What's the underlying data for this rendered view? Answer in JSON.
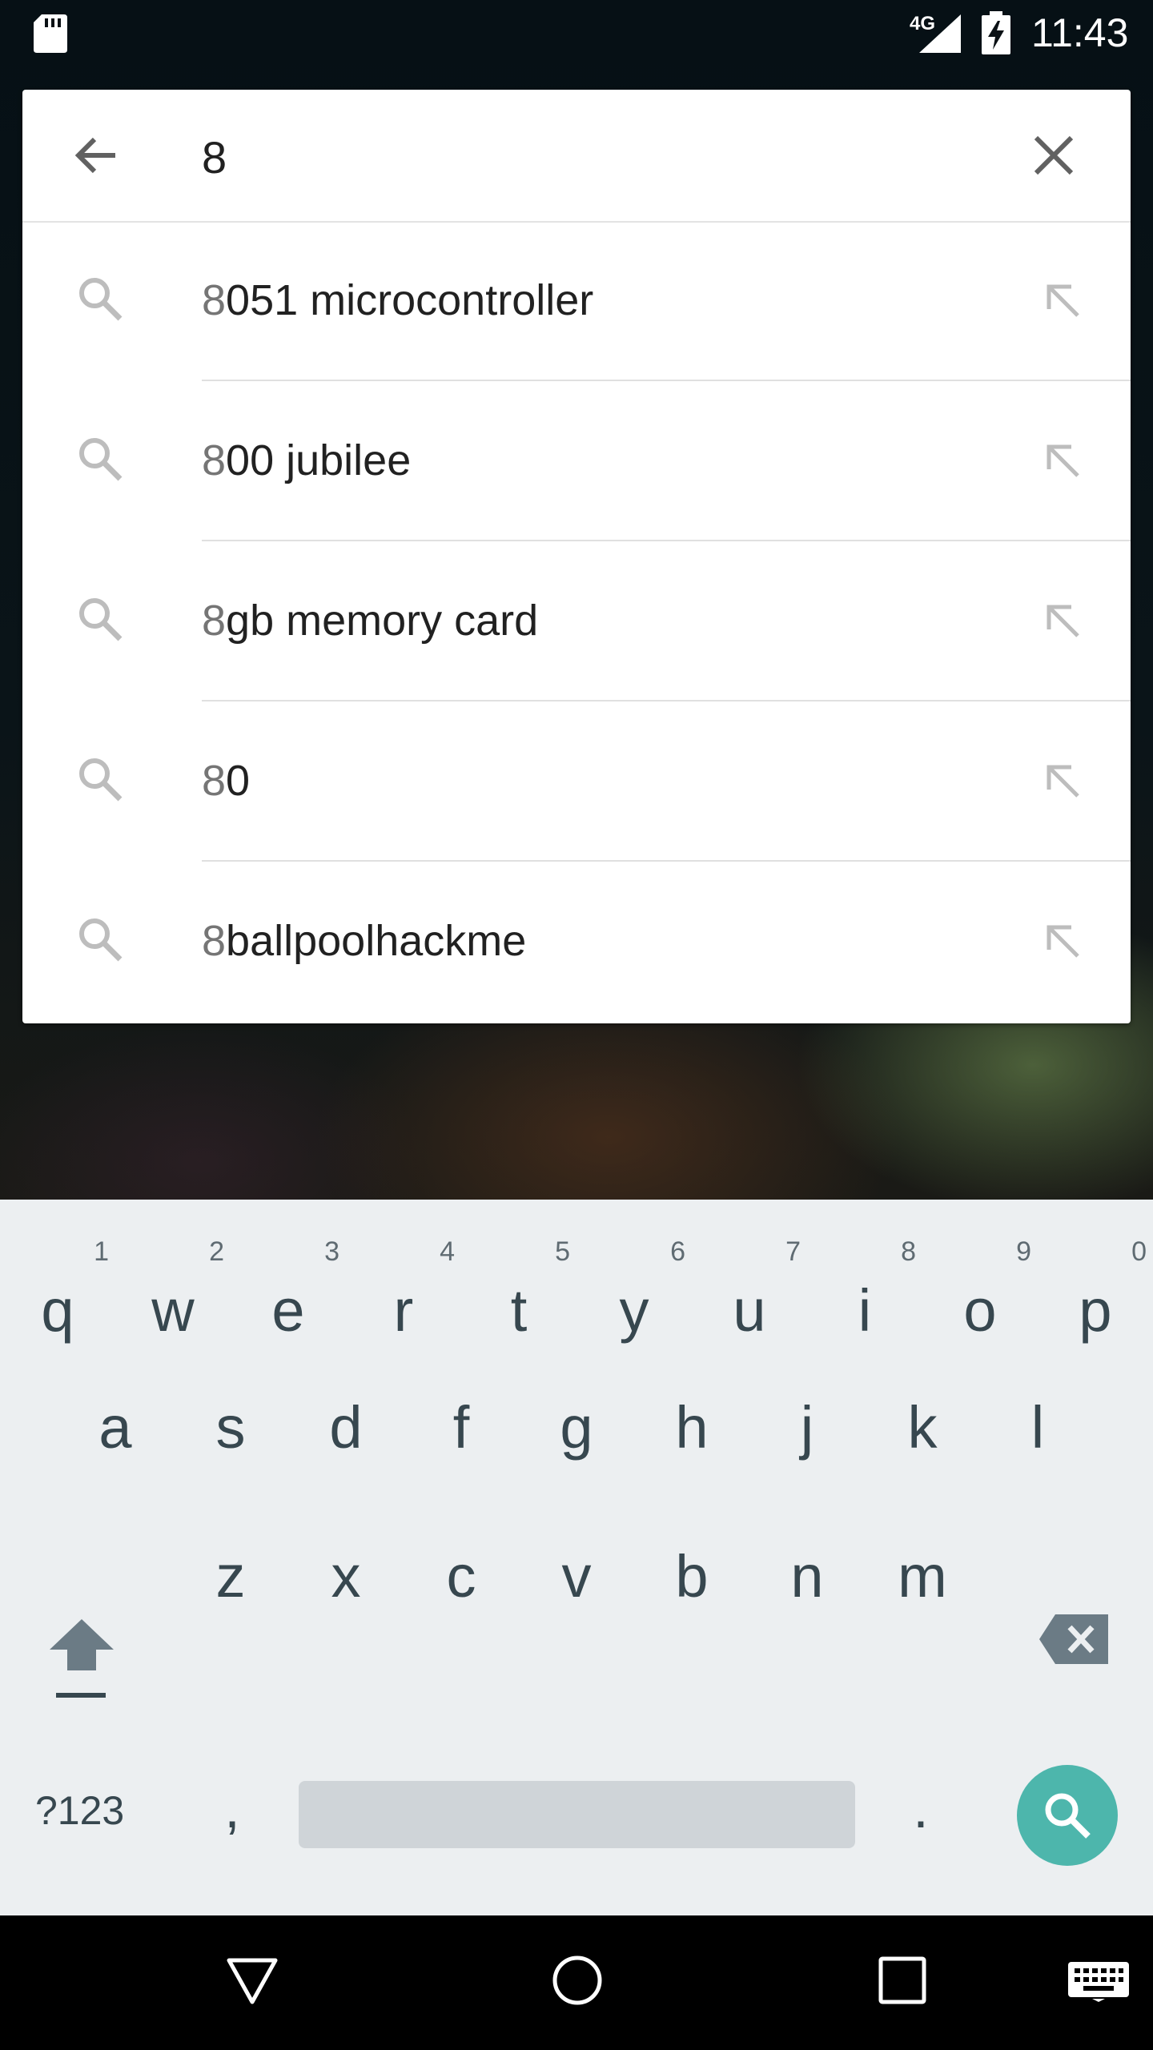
{
  "status_bar": {
    "network": "4G",
    "time": "11:43",
    "icons": [
      "sd-card-icon",
      "signal-icon",
      "battery-charging-icon"
    ]
  },
  "search": {
    "query": "8",
    "back_icon": "arrow-back-icon",
    "clear_icon": "close-icon"
  },
  "suggestions": [
    {
      "prefix": "8",
      "rest": "051 microcontroller",
      "icon": "search-icon",
      "action_icon": "arrow-up-left-icon"
    },
    {
      "prefix": "8",
      "rest": "00 jubilee",
      "icon": "search-icon",
      "action_icon": "arrow-up-left-icon"
    },
    {
      "prefix": "8",
      "rest": "gb memory card",
      "icon": "search-icon",
      "action_icon": "arrow-up-left-icon"
    },
    {
      "prefix": "8",
      "rest": "0",
      "icon": "search-icon",
      "action_icon": "arrow-up-left-icon"
    },
    {
      "prefix": "8",
      "rest": "ballpoolhackme",
      "icon": "search-icon",
      "action_icon": "arrow-up-left-icon"
    }
  ],
  "keyboard": {
    "row1": [
      {
        "key": "q",
        "hint": "1"
      },
      {
        "key": "w",
        "hint": "2"
      },
      {
        "key": "e",
        "hint": "3"
      },
      {
        "key": "r",
        "hint": "4"
      },
      {
        "key": "t",
        "hint": "5"
      },
      {
        "key": "y",
        "hint": "6"
      },
      {
        "key": "u",
        "hint": "7"
      },
      {
        "key": "i",
        "hint": "8"
      },
      {
        "key": "o",
        "hint": "9"
      },
      {
        "key": "p",
        "hint": "0"
      }
    ],
    "row2": [
      "a",
      "s",
      "d",
      "f",
      "g",
      "h",
      "j",
      "k",
      "l"
    ],
    "row3": [
      "z",
      "x",
      "c",
      "v",
      "b",
      "n",
      "m"
    ],
    "symbols_label": "?123",
    "comma": ",",
    "period": ".",
    "action_icon": "search-icon",
    "accent_color": "#4db6ac"
  },
  "nav_bar": {
    "icons": [
      "nav-back-icon",
      "nav-home-icon",
      "nav-recents-icon",
      "keyboard-icon"
    ]
  }
}
